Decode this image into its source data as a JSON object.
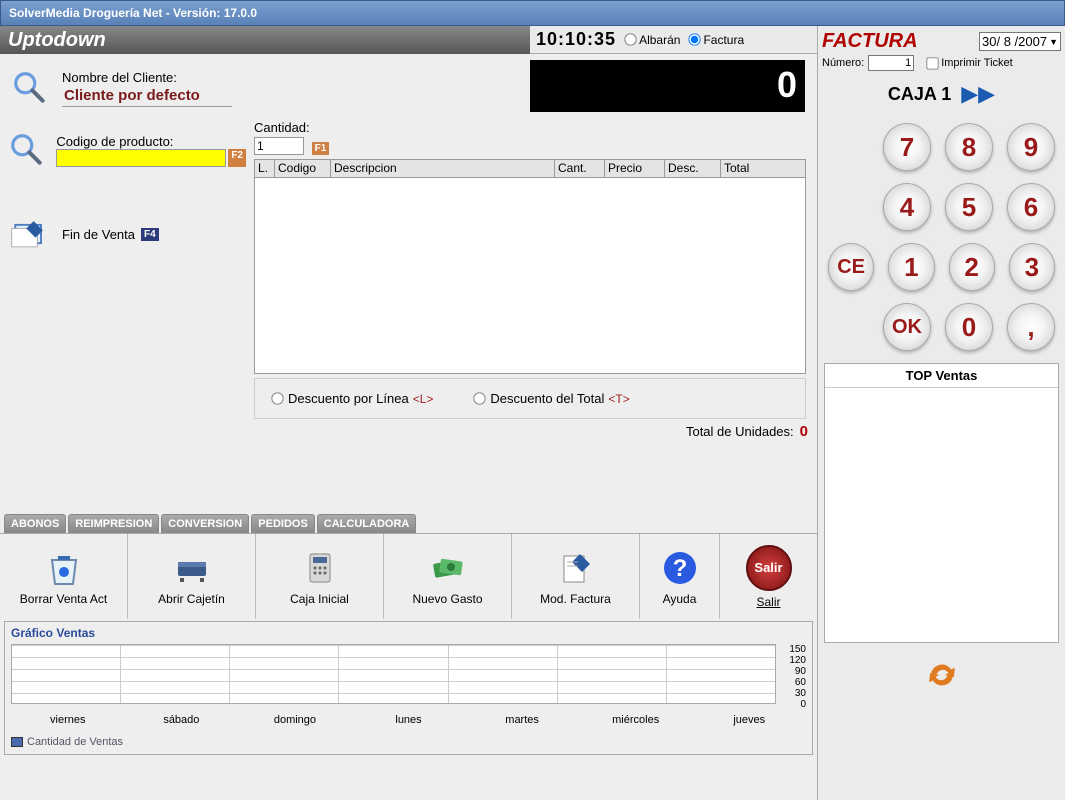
{
  "title": "SolverMedia Droguería Net    -    Versión: 17.0.0",
  "brand": "Uptodown",
  "clock": "10:10:35",
  "docType": {
    "albaran": "Albarán",
    "factura": "Factura"
  },
  "display_total": "0",
  "client": {
    "label": "Nombre del Cliente:",
    "value": "Cliente por defecto"
  },
  "product": {
    "label": "Codigo de producto:",
    "badgeF2": "F2",
    "qtyLabel": "Cantidad:",
    "qtyValue": "1",
    "badgeF1": "F1"
  },
  "finVenta": {
    "label": "Fin de Venta",
    "badge": "F4"
  },
  "tableHeaders": {
    "L": "L.",
    "Codigo": "Codigo",
    "Desc": "Descripcion",
    "Cant": "Cant.",
    "Precio": "Precio",
    "Descuento": "Desc.",
    "Total": "Total"
  },
  "discount": {
    "linea": "Descuento por Línea",
    "lineaKey": "<L>",
    "total": "Descuento del Total",
    "totalKey": "<T>"
  },
  "totalUnidades": {
    "label": "Total de Unidades:",
    "value": "0"
  },
  "tabs": [
    "ABONOS",
    "REIMPRESION",
    "CONVERSION",
    "PEDIDOS",
    "CALCULADORA"
  ],
  "toolbar": {
    "borrar": "Borrar Venta Act",
    "cajetin": "Abrir Cajetín",
    "cajaInicial": "Caja Inicial",
    "gasto": "Nuevo Gasto",
    "modFactura": "Mod. Factura",
    "ayuda": "Ayuda",
    "salir": "Salir",
    "salirBtn": "Salir"
  },
  "right": {
    "facturaLabel": "FACTURA",
    "date": "30/ 8 /2007",
    "numeroLabel": "Número:",
    "numero": "1",
    "imprimir": "Imprimir Ticket",
    "caja": "CAJA 1",
    "topVentas": "TOP Ventas"
  },
  "keypad": {
    "7": "7",
    "8": "8",
    "9": "9",
    "4": "4",
    "5": "5",
    "6": "6",
    "CE": "CE",
    "1": "1",
    "2": "2",
    "3": "3",
    "OK": "OK",
    "0": "0",
    ",": ","
  },
  "chart_data": {
    "type": "bar",
    "title": "Gráfico Ventas",
    "categories": [
      "viernes",
      "sábado",
      "domingo",
      "lunes",
      "martes",
      "miércoles",
      "jueves"
    ],
    "values": [
      0,
      0,
      0,
      0,
      0,
      0,
      0
    ],
    "yticks": [
      150,
      120,
      90,
      60,
      30,
      0
    ],
    "ylim": [
      0,
      150
    ],
    "legend": "Cantidad de Ventas"
  }
}
